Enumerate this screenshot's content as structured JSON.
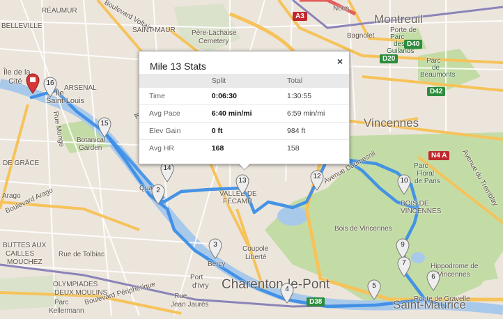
{
  "colors": {
    "route": "#3d8ee6",
    "land": "#ece5dc",
    "park": "#c3dca6",
    "water": "#a9c9ea",
    "road_major": "#f6c35a",
    "road_minor": "#ffffff",
    "pin": "#e9e9e9",
    "start_pin": "#d63737"
  },
  "map_labels": [
    {
      "text": "RÉAUMUR",
      "cls": "small"
    },
    {
      "text": "BELLEVILLE",
      "cls": "small"
    },
    {
      "text": "Boulevard Voltaire",
      "cls": "small"
    },
    {
      "text": "SAINT-MAUR",
      "cls": "small"
    },
    {
      "text": "Père-Lachaise",
      "cls": "small"
    },
    {
      "text": "Cemetery",
      "cls": "small"
    },
    {
      "text": "Montreuil",
      "cls": "big"
    },
    {
      "text": "Parc",
      "cls": "green"
    },
    {
      "text": "des",
      "cls": "green"
    },
    {
      "text": "Guilands",
      "cls": "green"
    },
    {
      "text": "Parc",
      "cls": "green"
    },
    {
      "text": "de",
      "cls": "green"
    },
    {
      "text": "Beaumonts",
      "cls": "green"
    },
    {
      "text": "Île de la",
      "cls": "med"
    },
    {
      "text": "Cité",
      "cls": "med"
    },
    {
      "text": "Île",
      "cls": "med"
    },
    {
      "text": "Saint-Louis",
      "cls": "med"
    },
    {
      "text": "ARSENAL",
      "cls": "small"
    },
    {
      "text": "Avenue Ledru",
      "cls": "small"
    },
    {
      "text": "Rue Monge",
      "cls": "small"
    },
    {
      "text": "Botanical",
      "cls": "small"
    },
    {
      "text": "Garden",
      "cls": "small"
    },
    {
      "text": "DE GRÂCE",
      "cls": "small"
    },
    {
      "text": "Arago",
      "cls": "small"
    },
    {
      "text": "Boulevard Arago",
      "cls": "small"
    },
    {
      "text": "Vincennes",
      "cls": "big"
    },
    {
      "text": "Parc",
      "cls": "green"
    },
    {
      "text": "Floral",
      "cls": "green"
    },
    {
      "text": "de Paris",
      "cls": "green"
    },
    {
      "text": "BOIS DE",
      "cls": "small"
    },
    {
      "text": "VINCENNES",
      "cls": "small"
    },
    {
      "text": "Avenue du Tremblay",
      "cls": "small"
    },
    {
      "text": "Bois de Vincennes",
      "cls": "small"
    },
    {
      "text": "Avenue Daumesnil",
      "cls": "small"
    },
    {
      "text": "VALLÉE DE",
      "cls": "small"
    },
    {
      "text": "FÉCAMP",
      "cls": "small"
    },
    {
      "text": "Quai",
      "cls": "small"
    },
    {
      "text": "BUTTES AUX",
      "cls": "small"
    },
    {
      "text": "CAILLES",
      "cls": "small"
    },
    {
      "text": "MOUCHEZ",
      "cls": "small"
    },
    {
      "text": "Rue de Tolbiac",
      "cls": "small"
    },
    {
      "text": "Bercy",
      "cls": "small"
    },
    {
      "text": "Coupole",
      "cls": "small"
    },
    {
      "text": "Liberté",
      "cls": "small"
    },
    {
      "text": "Charenton-le-Pont",
      "cls": "xl"
    },
    {
      "text": "OLYMPIADES",
      "cls": "small"
    },
    {
      "text": "DEUX MOULINS",
      "cls": "small"
    },
    {
      "text": "Parc",
      "cls": "small"
    },
    {
      "text": "Kellermann",
      "cls": "small"
    },
    {
      "text": "Boulevard Périphérique",
      "cls": "small"
    },
    {
      "text": "Port",
      "cls": "small"
    },
    {
      "text": "d'Ivry",
      "cls": "small"
    },
    {
      "text": "Rue",
      "cls": "small"
    },
    {
      "text": "Jean Jaurès",
      "cls": "small"
    },
    {
      "text": "Hippodrome de",
      "cls": "small"
    },
    {
      "text": "Vincennes",
      "cls": "small"
    },
    {
      "text": "Route de Gravelle",
      "cls": "small"
    },
    {
      "text": "Saint-Maurice",
      "cls": "big"
    },
    {
      "text": "Nous",
      "cls": "small"
    },
    {
      "text": "Bagnolet",
      "cls": "small"
    },
    {
      "text": "Porte de",
      "cls": "small"
    }
  ],
  "road_shields": [
    {
      "text": "A3",
      "type": "red"
    },
    {
      "text": "D20",
      "type": "green"
    },
    {
      "text": "D40",
      "type": "green"
    },
    {
      "text": "D42",
      "type": "green"
    },
    {
      "text": "N4 A",
      "type": "red"
    },
    {
      "text": "D38",
      "type": "green"
    }
  ],
  "markers": [
    "16",
    "15",
    "14",
    "2",
    "13",
    "12",
    "10",
    "9",
    "7",
    "6",
    "5",
    "4",
    "3"
  ],
  "popup": {
    "title": "Mile 13 Stats",
    "close": "×",
    "columns": [
      "",
      "Split",
      "Total"
    ],
    "rows": [
      {
        "label": "Time",
        "split": "0:06:30",
        "total": "1:30:55"
      },
      {
        "label": "Avg Pace",
        "split": "6:40 min/mi",
        "total": "6:59 min/mi"
      },
      {
        "label": "Elev Gain",
        "split": "0 ft",
        "total": "984 ft"
      },
      {
        "label": "Avg HR",
        "split": "168",
        "total": "158"
      }
    ]
  }
}
